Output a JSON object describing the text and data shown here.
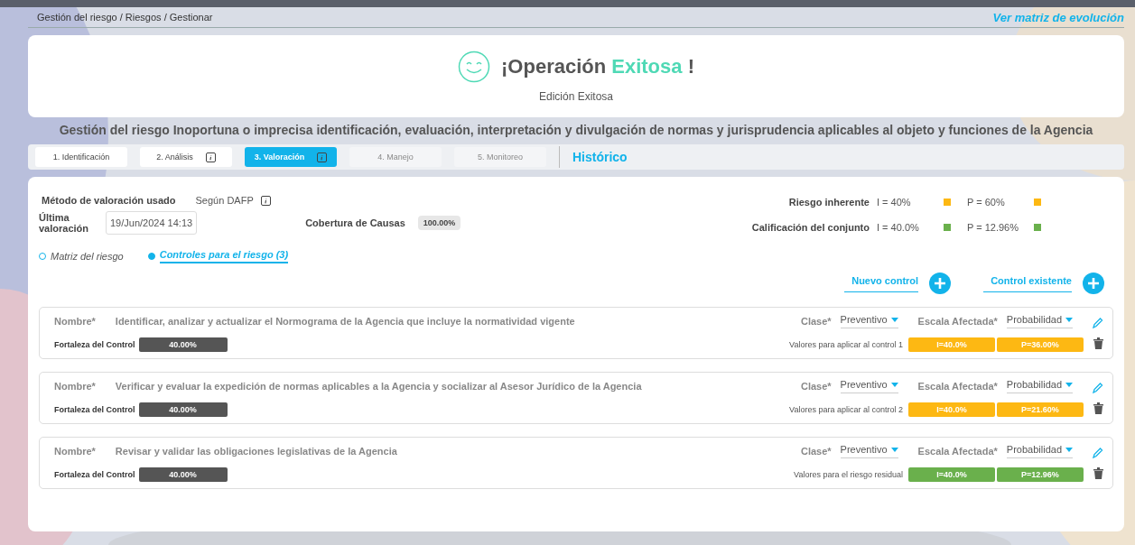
{
  "breadcrumb": "Gestión del riesgo / Riesgos / Gestionar",
  "evolution_link": "Ver matriz de evolución",
  "success": {
    "title_start": "¡Operación",
    "title_highlight": "Exitosa",
    "title_end": "!",
    "message": "Edición Exitosa"
  },
  "risk_title": "Gestión del riesgo Inoportuna o imprecisa identificación, evaluación, interpretación y divulgación de normas y jurisprudencia aplicables al objeto y funciones de la Agencia",
  "tabs": [
    {
      "label": "1. Identificación",
      "selected": false,
      "disabled": false,
      "info": false
    },
    {
      "label": "2. Análisis",
      "selected": false,
      "disabled": false,
      "info": true
    },
    {
      "label": "3. Valoración",
      "selected": true,
      "disabled": false,
      "info": true
    },
    {
      "label": "4. Manejo",
      "selected": false,
      "disabled": true,
      "info": false
    },
    {
      "label": "5. Monitoreo",
      "selected": false,
      "disabled": true,
      "info": false
    }
  ],
  "history_link": "Histórico",
  "method": {
    "label": "Método de valoración usado",
    "value": "Según DAFP"
  },
  "last_valuation": {
    "label": "Última valoración",
    "value": "19/Jun/2024 14:13"
  },
  "coverage": {
    "label": "Cobertura de Causas",
    "value": "100.00%"
  },
  "ratings": [
    {
      "label": "Riesgo inherente",
      "values": [
        {
          "text": "I = 40%",
          "color": "#fdb813"
        },
        {
          "text": "P = 60%",
          "color": "#fdb813"
        }
      ]
    },
    {
      "label": "Calificación del conjunto",
      "values": [
        {
          "text": "I = 40.0%",
          "color": "#6ab04c"
        },
        {
          "text": "P = 12.96%",
          "color": "#6ab04c"
        }
      ]
    }
  ],
  "views": [
    {
      "label": "Matriz del riesgo",
      "selected": false
    },
    {
      "label": "Controles para el riesgo (3)",
      "selected": true
    }
  ],
  "actions": [
    "Nuevo control",
    "Control existente"
  ],
  "controls": [
    {
      "name_label": "Nombre*",
      "name": "Identificar, analizar y actualizar el Normograma de la Agencia que incluye la normatividad vigente",
      "strength_label": "Fortaleza del Control",
      "strength": "40.00%",
      "class_label": "Clase*",
      "class": "Preventivo",
      "scale_label": "Escala Afectada*",
      "scale": "Probabilidad",
      "values_label": "Valores para aplicar al control 1",
      "i": "I=40.0%",
      "p": "P=36.00%",
      "color": "#fdb813"
    },
    {
      "name_label": "Nombre*",
      "name": "Verificar y evaluar la expedición de normas aplicables a la Agencia y socializar al Asesor Jurídico de la Agencia",
      "strength_label": "Fortaleza del Control",
      "strength": "40.00%",
      "class_label": "Clase*",
      "class": "Preventivo",
      "scale_label": "Escala Afectada*",
      "scale": "Probabilidad",
      "values_label": "Valores para aplicar al control 2",
      "i": "I=40.0%",
      "p": "P=21.60%",
      "color": "#fdb813"
    },
    {
      "name_label": "Nombre*",
      "name": "Revisar y validar las obligaciones legislativas de la Agencia",
      "strength_label": "Fortaleza del Control",
      "strength": "40.00%",
      "class_label": "Clase*",
      "class": "Preventivo",
      "scale_label": "Escala Afectada*",
      "scale": "Probabilidad",
      "values_label": "Valores para el riesgo residual",
      "i": "I=40.0%",
      "p": "P=12.96%",
      "color": "#6ab04c"
    }
  ]
}
